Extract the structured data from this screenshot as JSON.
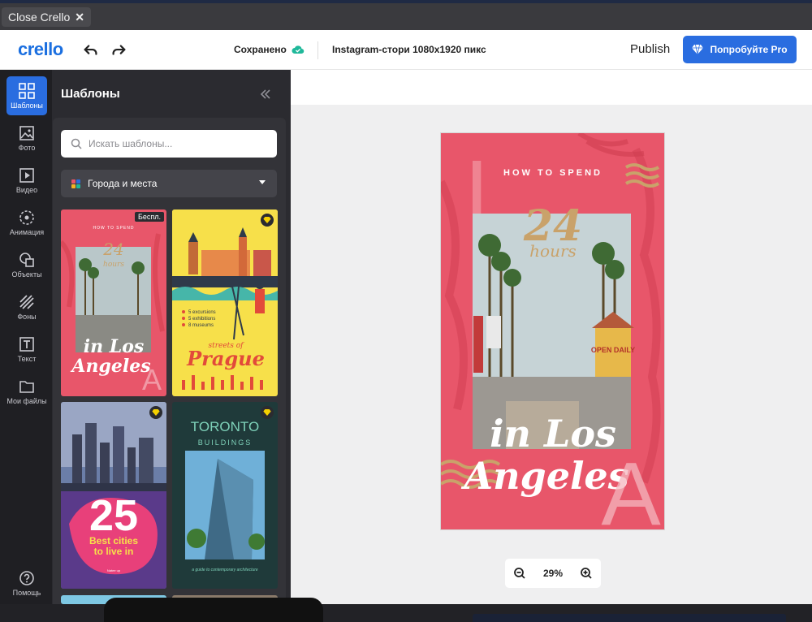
{
  "window": {
    "close_label": "Close Crello"
  },
  "header": {
    "logo": "crello",
    "saved_label": "Сохранено",
    "document_size": "Instagram-стори 1080x1920  пикс",
    "publish_label": "Publish",
    "try_pro_label": "Попробуйте Pro"
  },
  "rail": {
    "items": [
      {
        "label": "Шаблоны",
        "icon": "templates-icon"
      },
      {
        "label": "Фото",
        "icon": "photo-icon"
      },
      {
        "label": "Видео",
        "icon": "video-icon"
      },
      {
        "label": "Анимация",
        "icon": "animation-icon"
      },
      {
        "label": "Объекты",
        "icon": "objects-icon"
      },
      {
        "label": "Фоны",
        "icon": "backgrounds-icon"
      },
      {
        "label": "Текст",
        "icon": "text-icon"
      },
      {
        "label": "Мои файлы",
        "icon": "folder-icon"
      }
    ],
    "help_label": "Помощь"
  },
  "panel": {
    "title": "Шаблоны",
    "search_placeholder": "Искать шаблоны...",
    "category": "Города и места",
    "templates": [
      {
        "lines": [
          "HOW TO SPEND",
          "24",
          "hours",
          "in Los",
          "Angeles",
          "A"
        ],
        "badge": "Беспл."
      },
      {
        "lines": [
          "5 excursions",
          "5 exhibitions",
          "8 museums",
          "streets of",
          "Prague"
        ]
      },
      {
        "lines": [
          "25",
          "Best cities",
          "to live in",
          "Natee up"
        ]
      },
      {
        "lines": [
          "TORONTO",
          "BUILDINGS",
          "a guide to contemporary architecture"
        ]
      }
    ]
  },
  "canvas": {
    "story_lines": [
      "HOW TO SPEND",
      "24",
      "hours",
      "in Los",
      "Angeles",
      "A"
    ],
    "sign_text": "OPEN DAILY",
    "zoom": "29%"
  },
  "colors": {
    "accent": "#2a6de0",
    "story_bg": "#e8566a",
    "gold": "#c9a26a"
  }
}
